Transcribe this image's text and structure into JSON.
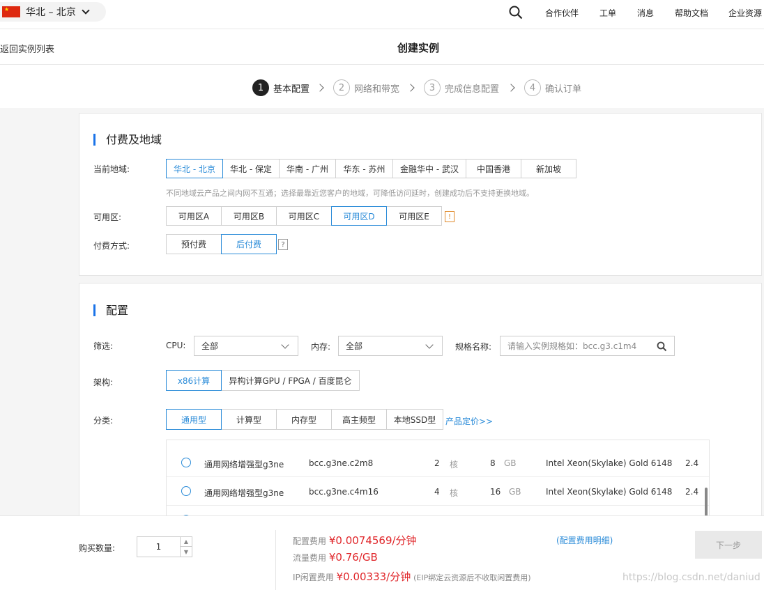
{
  "topbar": {
    "region": "华北 – 北京",
    "nav": [
      "合作伙伴",
      "工单",
      "消息",
      "帮助文档",
      "企业资源"
    ]
  },
  "subbar": {
    "back": "返回实例列表",
    "title": "创建实例"
  },
  "steps": [
    {
      "num": "1",
      "label": "基本配置"
    },
    {
      "num": "2",
      "label": "网络和带宽"
    },
    {
      "num": "3",
      "label": "完成信息配置"
    },
    {
      "num": "4",
      "label": "确认订单"
    }
  ],
  "billing": {
    "title": "付费及地域",
    "region_label": "当前地域:",
    "regions": [
      "华北 - 北京",
      "华北 - 保定",
      "华南 - 广州",
      "华东 - 苏州",
      "金融华中 - 武汉",
      "中国香港",
      "新加坡"
    ],
    "region_hint": "不同地域云产品之间内网不互通；选择最靠近您客户的地域，可降低访问延时，创建成功后不支持更换地域。",
    "zone_label": "可用区:",
    "zones": [
      "可用区A",
      "可用区B",
      "可用区C",
      "可用区D",
      "可用区E"
    ],
    "zone_warn": "!",
    "pay_label": "付费方式:",
    "pay_options": [
      "预付费",
      "后付费"
    ],
    "pay_help": "?"
  },
  "config": {
    "title": "配置",
    "filter_label": "筛选:",
    "cpu_label": "CPU:",
    "cpu_value": "全部",
    "mem_label": "内存:",
    "mem_value": "全部",
    "spec_label": "规格名称:",
    "spec_placeholder": "请输入实例规格如：bcc.g3.c1m4",
    "arch_label": "架构:",
    "arch_options": [
      "x86计算",
      "异构计算GPU / FPGA / 百度昆仑"
    ],
    "cat_label": "分类:",
    "categories": [
      "通用型",
      "计算型",
      "内存型",
      "高主频型",
      "本地SSD型"
    ],
    "pricing_link": "产品定价>>",
    "rows": [
      {
        "name": "通用网络增强型g3ne",
        "spec": "bcc.g3ne.c2m8",
        "cpu": "2",
        "cpu_unit": "核",
        "mem": "8",
        "mem_unit": "GB",
        "proc": "Intel Xeon(Skylake) Gold 6148",
        "freq": "2.4"
      },
      {
        "name": "通用网络增强型g3ne",
        "spec": "bcc.g3ne.c4m16",
        "cpu": "4",
        "cpu_unit": "核",
        "mem": "16",
        "mem_unit": "GB",
        "proc": "Intel Xeon(Skylake) Gold 6148",
        "freq": "2.4"
      }
    ]
  },
  "footer": {
    "qty_label": "购买数量:",
    "qty": "1",
    "fee1_label": "配置费用",
    "fee1_price": "¥0.0074569/分钟",
    "fee1_detail": "(配置费用明细)",
    "fee2_label": "流量费用",
    "fee2_price": "¥0.76/GB",
    "fee3_label": "IP闲置费用",
    "fee3_price": "¥0.00333/分钟",
    "fee3_note": "(EIP绑定云资源后不收取闲置费用)",
    "next": "下一步",
    "watermark": "https://blog.csdn.net/daniud"
  },
  "colors": {
    "accent": "#2a8bd8",
    "price": "#e0262a",
    "section_bar": "#1a73e8"
  }
}
